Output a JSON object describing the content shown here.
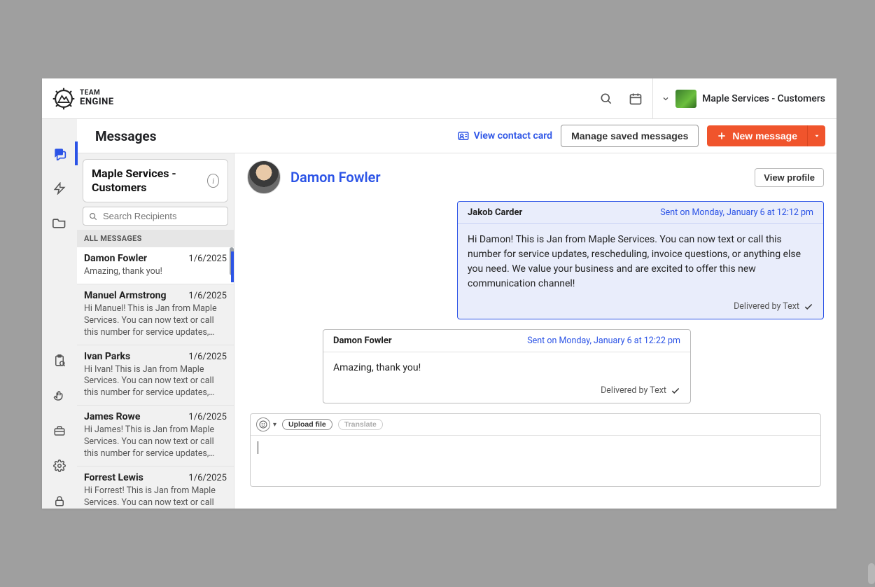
{
  "brand": {
    "line1": "TEAM",
    "line2": "ENGINE"
  },
  "account": {
    "name": "Maple Services - Customers"
  },
  "page": {
    "title": "Messages"
  },
  "actions": {
    "view_contact_card": "View contact card",
    "manage_saved": "Manage saved messages",
    "new_message": "New message"
  },
  "group": {
    "name": "Maple Services - Customers"
  },
  "search": {
    "placeholder": "Search Recipients"
  },
  "all_messages_header": "ALL MESSAGES",
  "threads": [
    {
      "name": "Damon Fowler",
      "date": "1/6/2025",
      "preview": "Amazing, thank you!"
    },
    {
      "name": "Manuel Armstrong",
      "date": "1/6/2025",
      "preview": "Hi Manuel! This is Jan from Maple Services. You can now text or call this number for service updates, rescheduling, invoice ques…"
    },
    {
      "name": "Ivan Parks",
      "date": "1/6/2025",
      "preview": "Hi Ivan! This is Jan from Maple Services. You can now text or call this number for service updates, rescheduling, invoice questions, o…"
    },
    {
      "name": "James Rowe",
      "date": "1/6/2025",
      "preview": "Hi James! This is Jan from Maple Services. You can now text or call this number for service updates, rescheduling, invoice ques…"
    },
    {
      "name": "Forrest Lewis",
      "date": "1/6/2025",
      "preview": "Hi Forrest! This is Jan from Maple Services. You can now text or call this number for service updates, rescheduling, invoice ques…"
    }
  ],
  "conversation": {
    "contact": "Damon Fowler",
    "view_profile": "View profile",
    "messages": [
      {
        "dir": "out",
        "sender": "Jakob Carder",
        "timestamp": "Sent on Monday, January 6 at 12:12 pm",
        "body": "Hi Damon! This is Jan from Maple Services. You can now text or call this number for service updates, rescheduling, invoice questions, or anything else you need. We value your business and are excited to offer this new communication channel!",
        "status": "Delivered by Text"
      },
      {
        "dir": "in",
        "sender": "Damon Fowler",
        "timestamp": "Sent on Monday, January 6 at 12:22 pm",
        "body": "Amazing, thank you!",
        "status": "Delivered by Text"
      }
    ]
  },
  "compose": {
    "upload": "Upload file",
    "translate": "Translate"
  }
}
